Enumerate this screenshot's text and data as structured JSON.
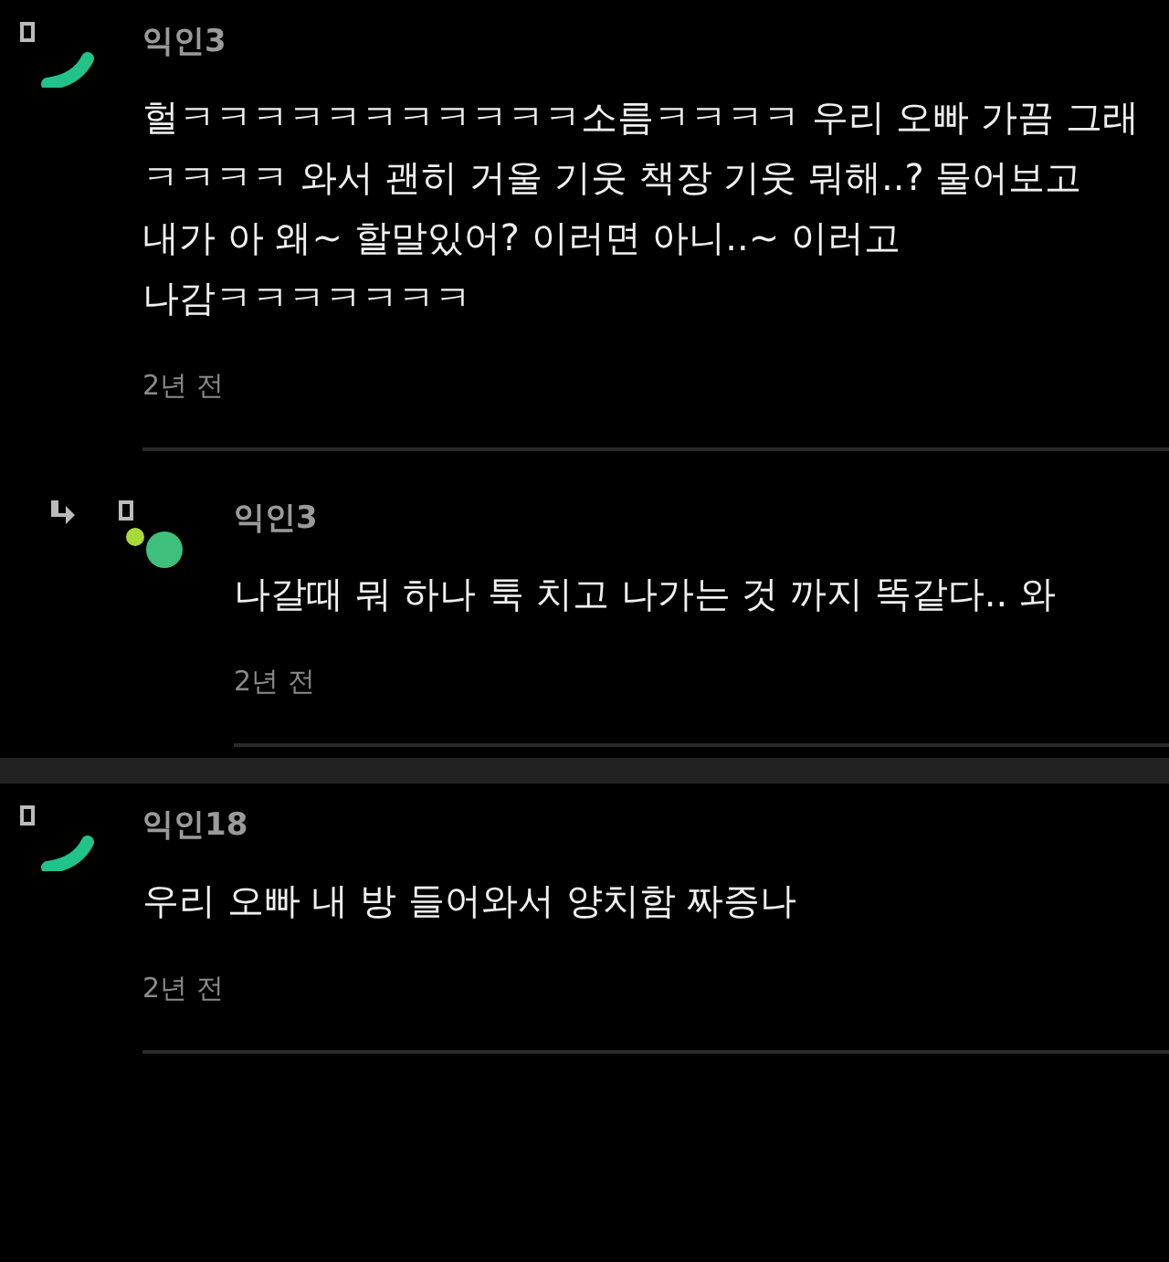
{
  "comments": [
    {
      "kind": "comment",
      "author": "익인3",
      "body": "헐ㅋㅋㅋㅋㅋㅋㅋㅋㅋㅋㅋ소름ㅋㅋㅋㅋ 우리 오빠 가끔 그래 ㅋㅋㅋㅋ 와서 괜히 거울 기웃 책장 기웃 뭐해..? 물어보고 내가 아 왜~ 할말있어? 이러면 아니..~ 이러고 나감ㅋㅋㅋㅋㅋㅋㅋ",
      "time": "2년 전"
    },
    {
      "kind": "reply",
      "author": "익인3",
      "body": "나갈때 뭐 하나 툭 치고 나가는 것 까지 똑같다.. 와",
      "time": "2년 전"
    },
    {
      "kind": "comment",
      "author": "익인18",
      "body": "우리 오빠 내 방 들어와서 양치함 짜증나",
      "time": "2년 전"
    }
  ]
}
